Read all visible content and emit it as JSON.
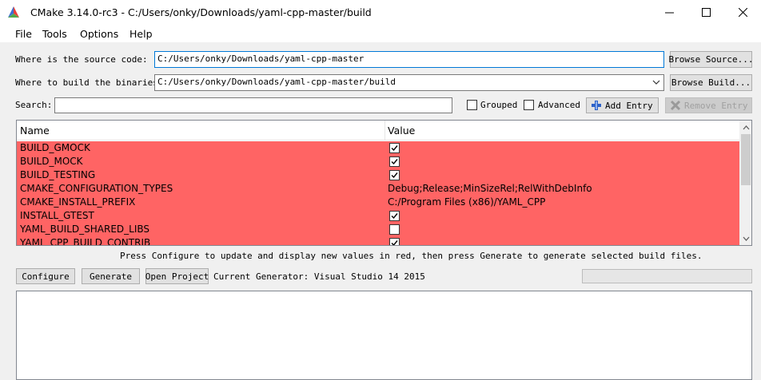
{
  "window": {
    "title": "CMake 3.14.0-rc3 - C:/Users/onky/Downloads/yaml-cpp-master/build"
  },
  "menu": {
    "file": "File",
    "tools": "Tools",
    "options": "Options",
    "help": "Help"
  },
  "source": {
    "label": "Where is the source code:",
    "value": "C:/Users/onky/Downloads/yaml-cpp-master",
    "browse": "Browse Source..."
  },
  "build": {
    "label": "Where to build the binaries:",
    "value": "C:/Users/onky/Downloads/yaml-cpp-master/build",
    "browse": "Browse Build..."
  },
  "search": {
    "label": "Search:",
    "value": "",
    "grouped": "Grouped",
    "advanced": "Advanced",
    "add_entry": "Add Entry",
    "remove_entry": "Remove Entry"
  },
  "table": {
    "col_name": "Name",
    "col_value": "Value",
    "rows": [
      {
        "name": "BUILD_GMOCK",
        "type": "bool",
        "checked": true
      },
      {
        "name": "BUILD_MOCK",
        "type": "bool",
        "checked": true
      },
      {
        "name": "BUILD_TESTING",
        "type": "bool",
        "checked": true
      },
      {
        "name": "CMAKE_CONFIGURATION_TYPES",
        "type": "text",
        "value": "Debug;Release;MinSizeRel;RelWithDebInfo"
      },
      {
        "name": "CMAKE_INSTALL_PREFIX",
        "type": "text",
        "value": "C:/Program Files (x86)/YAML_CPP"
      },
      {
        "name": "INSTALL_GTEST",
        "type": "bool",
        "checked": true
      },
      {
        "name": "YAML_BUILD_SHARED_LIBS",
        "type": "bool",
        "checked": false
      },
      {
        "name": "YAML_CPP_BUILD_CONTRIB",
        "type": "bool",
        "checked": true
      }
    ],
    "highlight_color": "#ff6464"
  },
  "hint": "Press Configure to update and display new values in red, then press Generate to generate selected build files.",
  "actions": {
    "configure": "Configure",
    "generate": "Generate",
    "open_project": "Open Project",
    "generator": "Current Generator: Visual Studio 14 2015"
  },
  "colors": {
    "accent": "#0078d7",
    "window_bg": "#f0f0f0"
  }
}
